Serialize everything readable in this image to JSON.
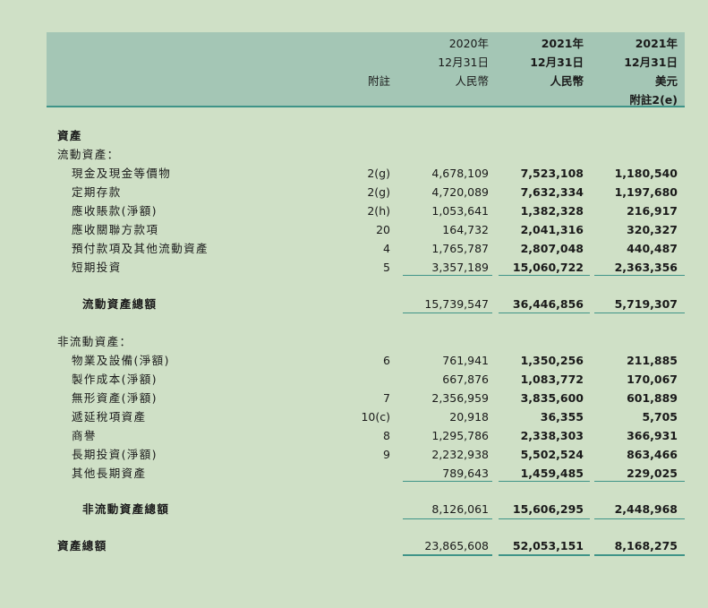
{
  "header": {
    "note_col": "附註",
    "col_2020": [
      "2020年",
      "12月31日",
      "人民幣"
    ],
    "col_2021_rmb": [
      "2021年",
      "12月31日",
      "人民幣"
    ],
    "col_2021_usd": [
      "2021年",
      "12月31日",
      "美元",
      "附註2(e)"
    ]
  },
  "sections": {
    "assets_title": "資產",
    "current_title": "流動資產：",
    "noncurrent_title": "非流動資產："
  },
  "current_rows": [
    {
      "label": "現金及現金等價物",
      "note": "2(g)",
      "v2020": "4,678,109",
      "v2021": "7,523,108",
      "usd": "1,180,540"
    },
    {
      "label": "定期存款",
      "note": "2(g)",
      "v2020": "4,720,089",
      "v2021": "7,632,334",
      "usd": "1,197,680"
    },
    {
      "label": "應收賬款(淨額)",
      "note": "2(h)",
      "v2020": "1,053,641",
      "v2021": "1,382,328",
      "usd": "216,917"
    },
    {
      "label": "應收關聯方款項",
      "note": "20",
      "v2020": "164,732",
      "v2021": "2,041,316",
      "usd": "320,327"
    },
    {
      "label": "預付款項及其他流動資產",
      "note": "4",
      "v2020": "1,765,787",
      "v2021": "2,807,048",
      "usd": "440,487"
    },
    {
      "label": "短期投資",
      "note": "5",
      "v2020": "3,357,189",
      "v2021": "15,060,722",
      "usd": "2,363,356"
    }
  ],
  "current_total": {
    "label": "流動資產總額",
    "v2020": "15,739,547",
    "v2021": "36,446,856",
    "usd": "5,719,307"
  },
  "noncurrent_rows": [
    {
      "label": "物業及設備(淨額)",
      "note": "6",
      "v2020": "761,941",
      "v2021": "1,350,256",
      "usd": "211,885"
    },
    {
      "label": "製作成本(淨額)",
      "note": "",
      "v2020": "667,876",
      "v2021": "1,083,772",
      "usd": "170,067"
    },
    {
      "label": "無形資產(淨額)",
      "note": "7",
      "v2020": "2,356,959",
      "v2021": "3,835,600",
      "usd": "601,889"
    },
    {
      "label": "遞延稅項資產",
      "note": "10(c)",
      "v2020": "20,918",
      "v2021": "36,355",
      "usd": "5,705"
    },
    {
      "label": "商譽",
      "note": "8",
      "v2020": "1,295,786",
      "v2021": "2,338,303",
      "usd": "366,931"
    },
    {
      "label": "長期投資(淨額)",
      "note": "9",
      "v2020": "2,232,938",
      "v2021": "5,502,524",
      "usd": "863,466"
    },
    {
      "label": "其他長期資產",
      "note": "",
      "v2020": "789,643",
      "v2021": "1,459,485",
      "usd": "229,025"
    }
  ],
  "noncurrent_total": {
    "label": "非流動資產總額",
    "v2020": "8,126,061",
    "v2021": "15,606,295",
    "usd": "2,448,968"
  },
  "total_assets": {
    "label": "資產總額",
    "v2020": "23,865,608",
    "v2021": "52,053,151",
    "usd": "8,168,275"
  }
}
